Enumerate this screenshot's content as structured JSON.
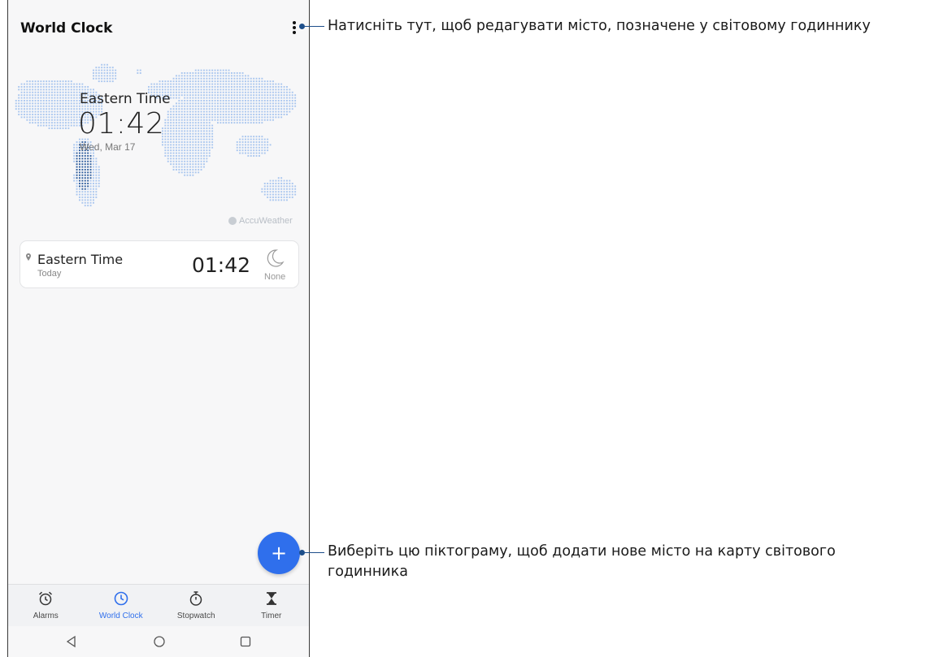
{
  "app": {
    "title": "World Clock"
  },
  "map": {
    "city": "Eastern Time",
    "time": "01:42",
    "date": "Wed, Mar 17",
    "attribution": "AccuWeather"
  },
  "city_card": {
    "city": "Eastern Time",
    "day": "Today",
    "time": "01:42",
    "weather_icon": "moon-icon",
    "weather_label": "None"
  },
  "fab": {
    "label": "+"
  },
  "bottom_nav": {
    "items": [
      {
        "label": "Alarms",
        "icon": "alarm-clock-icon",
        "active": false
      },
      {
        "label": "World Clock",
        "icon": "clock-icon",
        "active": true
      },
      {
        "label": "Stopwatch",
        "icon": "stopwatch-icon",
        "active": false
      },
      {
        "label": "Timer",
        "icon": "hourglass-icon",
        "active": false
      }
    ]
  },
  "system_nav": [
    "back-icon",
    "home-icon",
    "recents-icon"
  ],
  "callouts": {
    "menu": "Натисніть тут, щоб редагувати місто, позначене у світовому годиннику",
    "add_line1": "Виберіть цю піктограму, щоб додати нове місто на карту світового",
    "add_line2": "годинника"
  },
  "colors": {
    "accent": "#2f6fec",
    "callout": "#1d4e8a",
    "map_dots": "#a9c6ef",
    "map_highlight": "#2d5d9e"
  }
}
